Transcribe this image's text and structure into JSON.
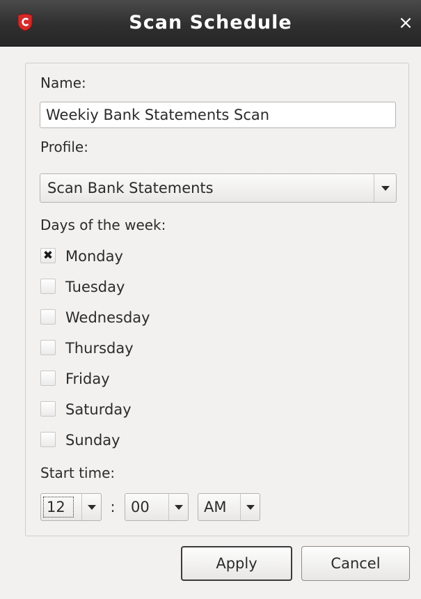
{
  "window": {
    "title": "Scan Schedule",
    "close_glyph": "×",
    "app_icon": "comodo-shield-icon",
    "brand_color": "#d42a2a"
  },
  "form": {
    "name_label": "Name:",
    "name_value": "Weekiy Bank Statements Scan",
    "profile_label": "Profile:",
    "profile_value": "Scan Bank Statements",
    "days_label": "Days of the week:",
    "days": [
      {
        "label": "Monday",
        "checked": true
      },
      {
        "label": "Tuesday",
        "checked": false
      },
      {
        "label": "Wednesday",
        "checked": false
      },
      {
        "label": "Thursday",
        "checked": false
      },
      {
        "label": "Friday",
        "checked": false
      },
      {
        "label": "Saturday",
        "checked": false
      },
      {
        "label": "Sunday",
        "checked": false
      }
    ],
    "start_time_label": "Start time:",
    "start_time": {
      "hour": "12",
      "separator": ":",
      "minute": "00",
      "period": "AM"
    }
  },
  "buttons": {
    "apply": "Apply",
    "cancel": "Cancel"
  }
}
